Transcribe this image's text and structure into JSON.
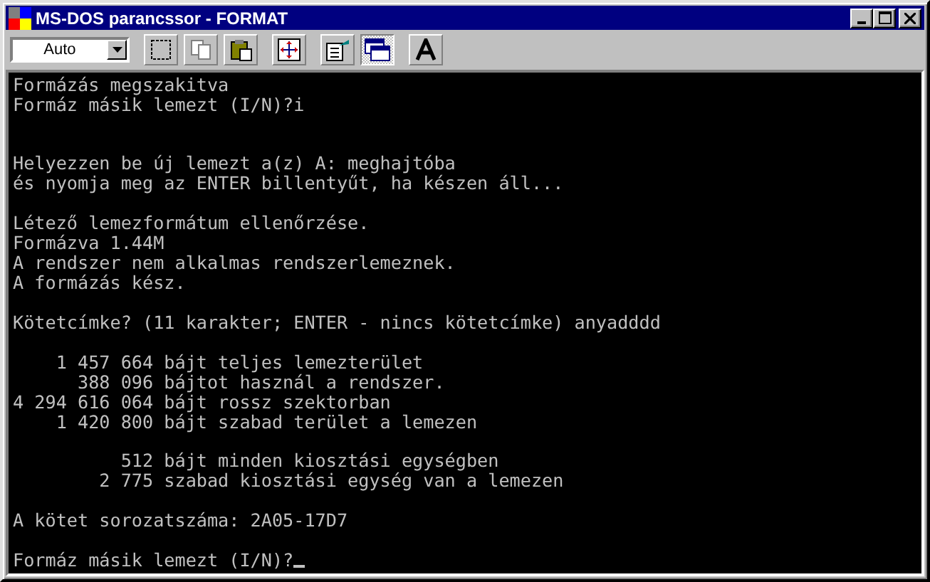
{
  "window": {
    "title": "MS-DOS parancssor - FORMAT"
  },
  "toolbar": {
    "font_size": "Auto",
    "buttons": [
      {
        "kind": "mark",
        "pressed": false
      },
      {
        "kind": "copy",
        "pressed": false
      },
      {
        "kind": "paste",
        "pressed": false
      },
      {
        "kind": "fullscreen",
        "pressed": false
      },
      {
        "kind": "properties",
        "pressed": false
      },
      {
        "kind": "background",
        "pressed": true
      },
      {
        "kind": "font",
        "pressed": false
      }
    ]
  },
  "console": {
    "lines": [
      {
        "kind": "text",
        "text": "Formázás megszakitva"
      },
      {
        "kind": "text",
        "text": "Formáz másik lemezt (I/N)?i"
      },
      {
        "kind": "blank"
      },
      {
        "kind": "blank"
      },
      {
        "kind": "text",
        "text": "Helyezzen be új lemezt a(z) A: meghajtóba"
      },
      {
        "kind": "text",
        "text": "és nyomja meg az ENTER billentyűt, ha készen áll..."
      },
      {
        "kind": "blank"
      },
      {
        "kind": "text",
        "text": "Létező lemezformátum ellenőrzése."
      },
      {
        "kind": "text",
        "text": "Formázva 1.44M"
      },
      {
        "kind": "text",
        "text": "A rendszer nem alkalmas rendszerlemeznek."
      },
      {
        "kind": "text",
        "text": "A formázás kész."
      },
      {
        "kind": "blank"
      },
      {
        "kind": "text",
        "text": "Kötetcímke? (11 karakter; ENTER - nincs kötetcímke) anyadddd"
      },
      {
        "kind": "blank"
      },
      {
        "kind": "text",
        "text": "    1 457 664 bájt teljes lemezterület"
      },
      {
        "kind": "text",
        "text": "      388 096 bájtot használ a rendszer."
      },
      {
        "kind": "text",
        "text": "4 294 616 064 bájt rossz szektorban"
      },
      {
        "kind": "text",
        "text": "    1 420 800 bájt szabad terület a lemezen"
      },
      {
        "kind": "blank"
      },
      {
        "kind": "text",
        "text": "          512 bájt minden kiosztási egységben"
      },
      {
        "kind": "text",
        "text": "        2 775 szabad kiosztási egység van a lemezen"
      },
      {
        "kind": "blank"
      },
      {
        "kind": "text",
        "text": "A kötet sorozatszáma: 2A05-17D7"
      },
      {
        "kind": "blank"
      }
    ],
    "prompt": {
      "text": "Formáz másik lemezt (I/N)?",
      "cursor": true
    }
  }
}
